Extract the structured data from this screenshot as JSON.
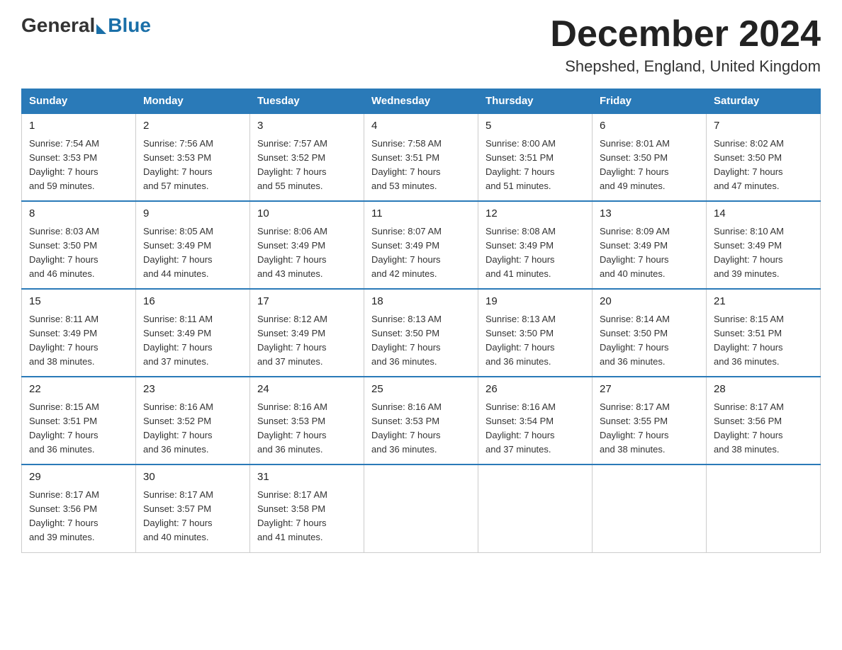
{
  "header": {
    "logo_general": "General",
    "logo_blue": "Blue",
    "title": "December 2024",
    "subtitle": "Shepshed, England, United Kingdom"
  },
  "days_of_week": [
    "Sunday",
    "Monday",
    "Tuesday",
    "Wednesday",
    "Thursday",
    "Friday",
    "Saturday"
  ],
  "weeks": [
    [
      {
        "num": "1",
        "sunrise": "7:54 AM",
        "sunset": "3:53 PM",
        "daylight": "7 hours and 59 minutes."
      },
      {
        "num": "2",
        "sunrise": "7:56 AM",
        "sunset": "3:53 PM",
        "daylight": "7 hours and 57 minutes."
      },
      {
        "num": "3",
        "sunrise": "7:57 AM",
        "sunset": "3:52 PM",
        "daylight": "7 hours and 55 minutes."
      },
      {
        "num": "4",
        "sunrise": "7:58 AM",
        "sunset": "3:51 PM",
        "daylight": "7 hours and 53 minutes."
      },
      {
        "num": "5",
        "sunrise": "8:00 AM",
        "sunset": "3:51 PM",
        "daylight": "7 hours and 51 minutes."
      },
      {
        "num": "6",
        "sunrise": "8:01 AM",
        "sunset": "3:50 PM",
        "daylight": "7 hours and 49 minutes."
      },
      {
        "num": "7",
        "sunrise": "8:02 AM",
        "sunset": "3:50 PM",
        "daylight": "7 hours and 47 minutes."
      }
    ],
    [
      {
        "num": "8",
        "sunrise": "8:03 AM",
        "sunset": "3:50 PM",
        "daylight": "7 hours and 46 minutes."
      },
      {
        "num": "9",
        "sunrise": "8:05 AM",
        "sunset": "3:49 PM",
        "daylight": "7 hours and 44 minutes."
      },
      {
        "num": "10",
        "sunrise": "8:06 AM",
        "sunset": "3:49 PM",
        "daylight": "7 hours and 43 minutes."
      },
      {
        "num": "11",
        "sunrise": "8:07 AM",
        "sunset": "3:49 PM",
        "daylight": "7 hours and 42 minutes."
      },
      {
        "num": "12",
        "sunrise": "8:08 AM",
        "sunset": "3:49 PM",
        "daylight": "7 hours and 41 minutes."
      },
      {
        "num": "13",
        "sunrise": "8:09 AM",
        "sunset": "3:49 PM",
        "daylight": "7 hours and 40 minutes."
      },
      {
        "num": "14",
        "sunrise": "8:10 AM",
        "sunset": "3:49 PM",
        "daylight": "7 hours and 39 minutes."
      }
    ],
    [
      {
        "num": "15",
        "sunrise": "8:11 AM",
        "sunset": "3:49 PM",
        "daylight": "7 hours and 38 minutes."
      },
      {
        "num": "16",
        "sunrise": "8:11 AM",
        "sunset": "3:49 PM",
        "daylight": "7 hours and 37 minutes."
      },
      {
        "num": "17",
        "sunrise": "8:12 AM",
        "sunset": "3:49 PM",
        "daylight": "7 hours and 37 minutes."
      },
      {
        "num": "18",
        "sunrise": "8:13 AM",
        "sunset": "3:50 PM",
        "daylight": "7 hours and 36 minutes."
      },
      {
        "num": "19",
        "sunrise": "8:13 AM",
        "sunset": "3:50 PM",
        "daylight": "7 hours and 36 minutes."
      },
      {
        "num": "20",
        "sunrise": "8:14 AM",
        "sunset": "3:50 PM",
        "daylight": "7 hours and 36 minutes."
      },
      {
        "num": "21",
        "sunrise": "8:15 AM",
        "sunset": "3:51 PM",
        "daylight": "7 hours and 36 minutes."
      }
    ],
    [
      {
        "num": "22",
        "sunrise": "8:15 AM",
        "sunset": "3:51 PM",
        "daylight": "7 hours and 36 minutes."
      },
      {
        "num": "23",
        "sunrise": "8:16 AM",
        "sunset": "3:52 PM",
        "daylight": "7 hours and 36 minutes."
      },
      {
        "num": "24",
        "sunrise": "8:16 AM",
        "sunset": "3:53 PM",
        "daylight": "7 hours and 36 minutes."
      },
      {
        "num": "25",
        "sunrise": "8:16 AM",
        "sunset": "3:53 PM",
        "daylight": "7 hours and 36 minutes."
      },
      {
        "num": "26",
        "sunrise": "8:16 AM",
        "sunset": "3:54 PM",
        "daylight": "7 hours and 37 minutes."
      },
      {
        "num": "27",
        "sunrise": "8:17 AM",
        "sunset": "3:55 PM",
        "daylight": "7 hours and 38 minutes."
      },
      {
        "num": "28",
        "sunrise": "8:17 AM",
        "sunset": "3:56 PM",
        "daylight": "7 hours and 38 minutes."
      }
    ],
    [
      {
        "num": "29",
        "sunrise": "8:17 AM",
        "sunset": "3:56 PM",
        "daylight": "7 hours and 39 minutes."
      },
      {
        "num": "30",
        "sunrise": "8:17 AM",
        "sunset": "3:57 PM",
        "daylight": "7 hours and 40 minutes."
      },
      {
        "num": "31",
        "sunrise": "8:17 AM",
        "sunset": "3:58 PM",
        "daylight": "7 hours and 41 minutes."
      },
      null,
      null,
      null,
      null
    ]
  ],
  "labels": {
    "sunrise": "Sunrise:",
    "sunset": "Sunset:",
    "daylight": "Daylight:"
  }
}
